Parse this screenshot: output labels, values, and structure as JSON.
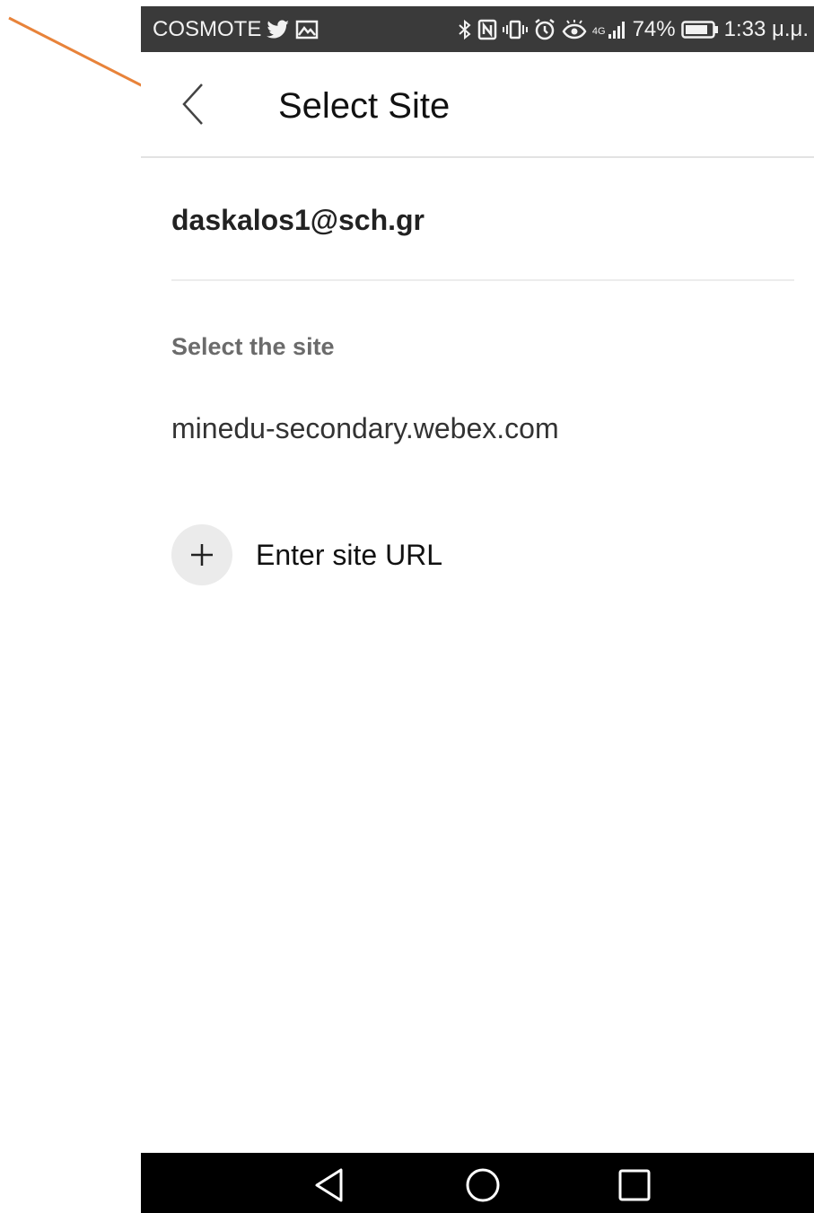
{
  "colors": {
    "status_bar_bg": "#3a3a3a",
    "nav_bar_bg": "#000000",
    "annotation_arrow": "#e8833a",
    "divider": "#e2e2e2",
    "plus_circle_bg": "#ebebeb"
  },
  "status_bar": {
    "carrier": "COSMOTE",
    "network": "4G",
    "battery": "74%",
    "time": "1:33 μ.μ.",
    "icons": [
      "twitter-icon",
      "gallery-icon",
      "bluetooth-icon",
      "nfc-icon",
      "vibrate-icon",
      "alarm-icon",
      "eye-comfort-icon",
      "signal-icon",
      "battery-icon"
    ]
  },
  "header": {
    "title": "Select Site",
    "back_icon": "chevron-left-icon"
  },
  "account": {
    "email": "daskalos1@sch.gr"
  },
  "sites": {
    "section_label": "Select the site",
    "items": [
      {
        "label": "minedu-secondary.webex.com"
      }
    ],
    "enter_url_label": "Enter site URL",
    "enter_url_icon": "plus-icon"
  },
  "nav_bar": {
    "icons": [
      "nav-back-icon",
      "nav-home-icon",
      "nav-recents-icon"
    ]
  }
}
